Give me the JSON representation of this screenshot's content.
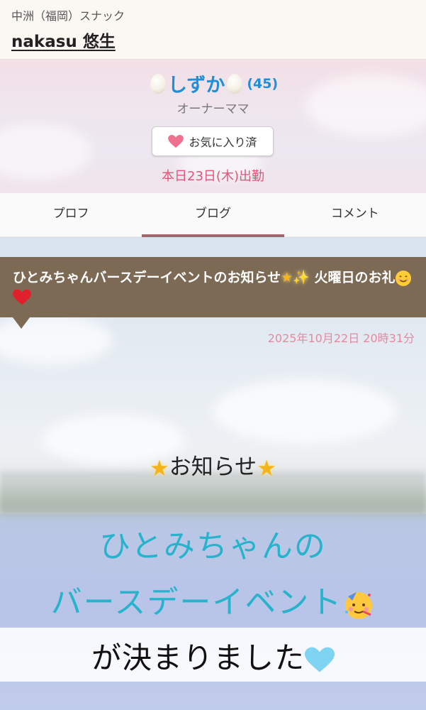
{
  "header": {
    "category": "中洲（福岡）スナック",
    "shop_name": "nakasu 悠生"
  },
  "profile": {
    "name": "しずか",
    "age": "(45)",
    "role": "オーナーママ",
    "favorite_label": "お気に入り済",
    "attendance": "本日23日(木)出勤"
  },
  "tabs": [
    {
      "label": "プロフ"
    },
    {
      "label": "ブログ",
      "active": true
    },
    {
      "label": "コメント"
    }
  ],
  "blog": {
    "title_part1": "ひとみちゃんバースデーイベントのお知らせ",
    "title_part2": "火曜日のお礼",
    "date": "2025年10月22日 20時31分",
    "line1": "お知らせ",
    "line2": "ひとみちゃんの",
    "line3": "バースデーイベント",
    "line4": "が決まりました"
  },
  "colors": {
    "accent_blue": "#1f8fd6",
    "pink": "#e0567a",
    "tab_active": "#a0676c",
    "blog_bar": "#7d6a55",
    "teal_text": "#27b3cc"
  }
}
